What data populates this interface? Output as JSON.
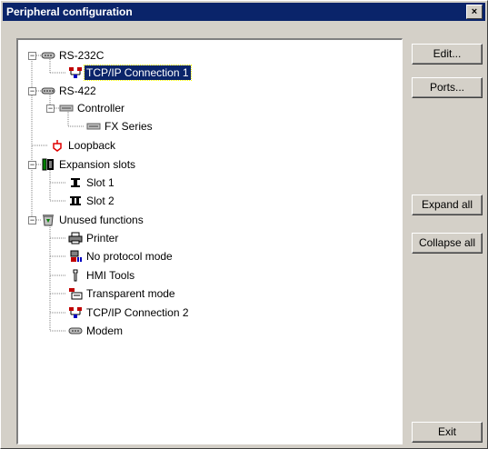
{
  "window": {
    "title": "Peripheral configuration",
    "close_label": "×"
  },
  "buttons": {
    "edit": "Edit...",
    "ports": "Ports...",
    "expand_all": "Expand all",
    "collapse_all": "Collapse all",
    "exit": "Exit"
  },
  "tree": {
    "rs232c": {
      "label": "RS-232C",
      "children": [
        "TCP/IP Connection 1"
      ]
    },
    "rs422": {
      "label": "RS-422",
      "controller": "Controller",
      "fx": "FX Series"
    },
    "loopback": "Loopback",
    "expansion": {
      "label": "Expansion slots",
      "slots": [
        "Slot 1",
        "Slot 2"
      ]
    },
    "unused": {
      "label": "Unused functions",
      "items": [
        "Printer",
        "No protocol mode",
        "HMI Tools",
        "Transparent mode",
        "TCP/IP Connection 2",
        "Modem"
      ]
    }
  },
  "selected_item": "TCP/IP Connection 1"
}
